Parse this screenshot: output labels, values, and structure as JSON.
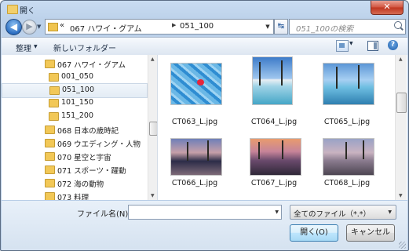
{
  "window": {
    "title": "開く",
    "close_symbol": "✕"
  },
  "nav": {
    "back_symbol": "◀",
    "forward_symbol": "▶"
  },
  "address": {
    "prefix": "«",
    "crumbs": [
      "067 ハワイ・グアム",
      "051_100"
    ],
    "separator": "▶",
    "refresh_symbol": "↹"
  },
  "search": {
    "placeholder": "051_100の検索"
  },
  "toolbar": {
    "organize": "整理",
    "new_folder": "新しいフォルダー",
    "help": "?"
  },
  "tree": [
    {
      "label": "067 ハワイ・グアム",
      "selected": false
    },
    {
      "label": "001_050",
      "selected": false
    },
    {
      "label": "051_100",
      "selected": true
    },
    {
      "label": "101_150",
      "selected": false
    },
    {
      "label": "151_200",
      "selected": false
    },
    {
      "label": "068 日本の歳時記",
      "selected": false
    },
    {
      "label": "069 ウエディング・人物",
      "selected": false
    },
    {
      "label": "070 星空と宇宙",
      "selected": false
    },
    {
      "label": "071 スポーツ・躍動",
      "selected": false
    },
    {
      "label": "072 海の動物",
      "selected": false
    },
    {
      "label": "073 料理",
      "selected": false
    }
  ],
  "files": [
    {
      "name": "CT063_L.jpg"
    },
    {
      "name": "CT064_L.jpg"
    },
    {
      "name": "CT065_L.jpg"
    },
    {
      "name": "CT066_L.jpg"
    },
    {
      "name": "CT067_L.jpg"
    },
    {
      "name": "CT068_L.jpg"
    }
  ],
  "bottom": {
    "filename_label": "ファイル名(N):",
    "filename_value": "",
    "filetype": "全てのファイル（*.*）",
    "open_label": "開く(O)",
    "cancel_label": "キャンセル"
  },
  "colors": {
    "accent": "#2d6fc2",
    "selection": "#e3ecf5"
  }
}
